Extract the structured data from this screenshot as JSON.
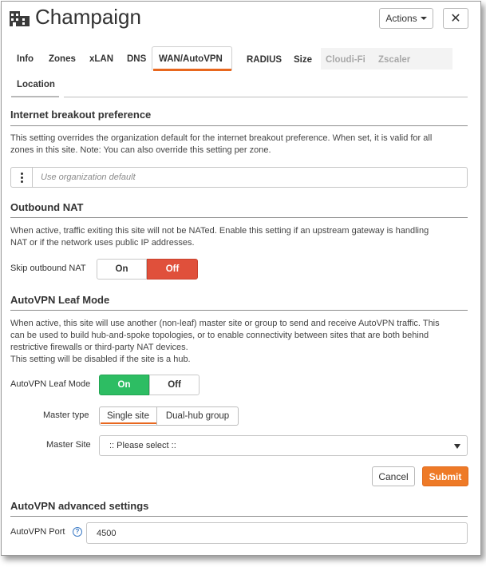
{
  "header": {
    "title": "Champaign",
    "actions_label": "Actions",
    "close_label": "✕",
    "icon": "building-icon"
  },
  "tabs": [
    {
      "label": "Info",
      "state": "normal"
    },
    {
      "label": "Zones",
      "state": "normal"
    },
    {
      "label": "xLAN",
      "state": "normal"
    },
    {
      "label": "DNS",
      "state": "normal"
    },
    {
      "label": "WAN/AutoVPN",
      "state": "active"
    },
    {
      "label": "RADIUS",
      "state": "normal"
    },
    {
      "label": "Size",
      "state": "normal"
    },
    {
      "label": "Cloudi-Fi",
      "state": "disabled"
    },
    {
      "label": "Zscaler",
      "state": "disabled"
    },
    {
      "label": "Location",
      "state": "normal"
    }
  ],
  "internet_breakout": {
    "heading": "Internet breakout preference",
    "description_line1": "This setting overrides the organization default for the internet breakout preference. When set, it is valid for all",
    "description_line2": "zones in this site. Note: You can also override this setting per zone.",
    "placeholder": "Use organization default"
  },
  "outbound_nat": {
    "heading": "Outbound NAT",
    "description_line1": "When active, traffic exiting this site will not be NATed. Enable this setting if an upstream gateway is handling",
    "description_line2": "NAT or if the network uses public IP addresses.",
    "toggle_label": "Skip outbound NAT",
    "on_label": "On",
    "off_label": "Off",
    "selected": "Off"
  },
  "autovpn_leaf": {
    "heading": "AutoVPN Leaf Mode",
    "description_line1": "When active, this site will use another (non-leaf) master site or group to send and receive AutoVPN traffic. This",
    "description_line2": "can be used to build hub-and-spoke topologies, or to enable connectivity between sites that are both behind",
    "description_line3": "restrictive firewalls or third-party NAT devices.",
    "description_line4": "This setting will be disabled if the site is a hub.",
    "toggle_label": "AutoVPN Leaf Mode",
    "on_label": "On",
    "off_label": "Off",
    "selected": "On",
    "master_type_label": "Master type",
    "master_type_options": [
      "Single site",
      "Dual-hub group"
    ],
    "master_type_selected": "Single site",
    "master_site_label": "Master Site",
    "master_site_value": ":: Please select ::",
    "cancel_label": "Cancel",
    "submit_label": "Submit"
  },
  "autovpn_advanced": {
    "heading": "AutoVPN advanced settings",
    "port_label": "AutoVPN Port",
    "port_value": "4500",
    "help_icon": "question-circle-icon"
  },
  "colors": {
    "accent": "#e8671e",
    "submit": "#ee7a27",
    "toggle_on_green": "#2dbd63",
    "toggle_off_red": "#e0503b",
    "help_blue": "#3c7bc6"
  }
}
